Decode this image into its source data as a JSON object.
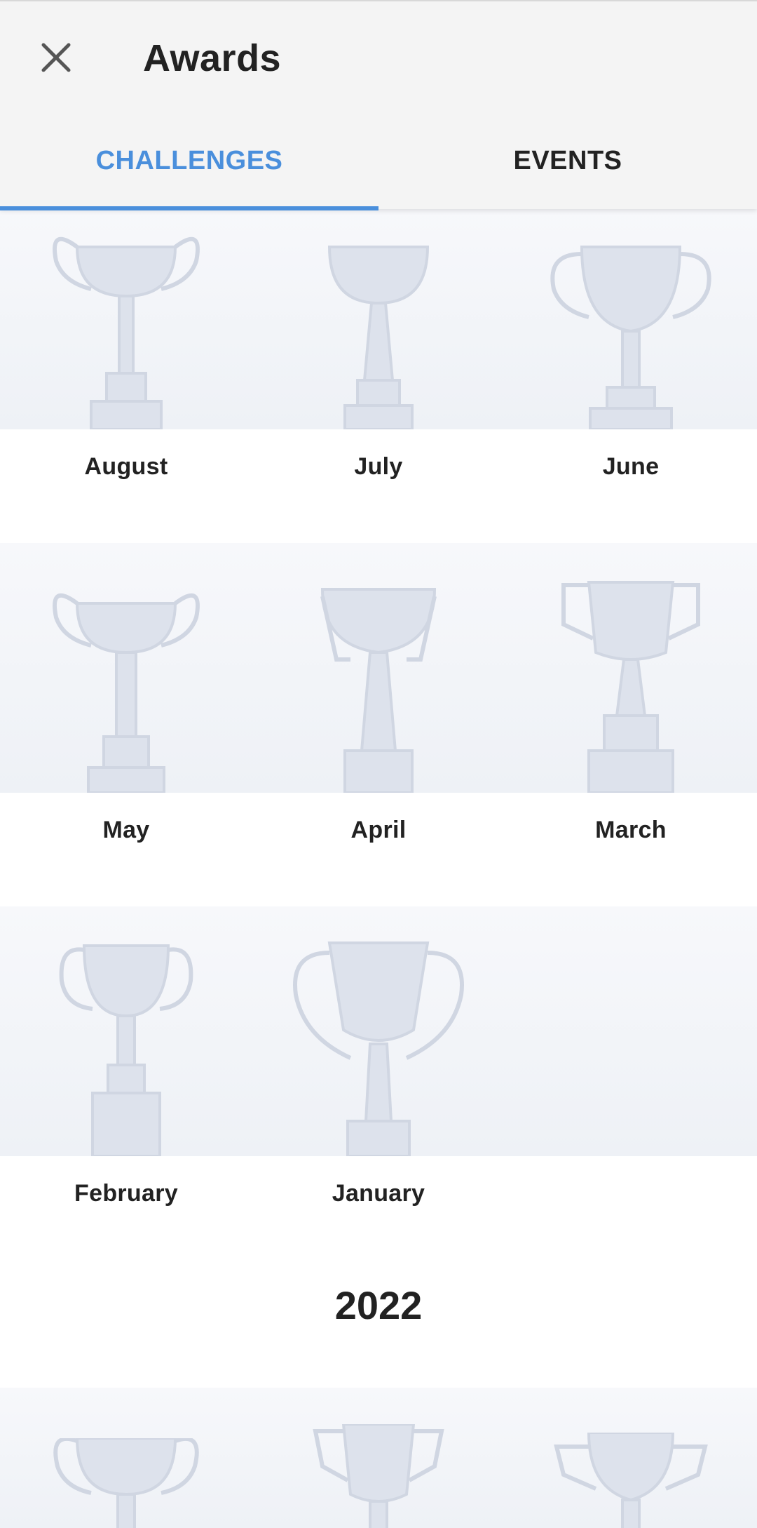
{
  "header": {
    "title": "Awards",
    "close_icon": "close-icon"
  },
  "tabs": [
    {
      "label": "CHALLENGES",
      "active": true
    },
    {
      "label": "EVENTS",
      "active": false
    }
  ],
  "awards": [
    {
      "label": "August"
    },
    {
      "label": "July"
    },
    {
      "label": "June"
    },
    {
      "label": "May"
    },
    {
      "label": "April"
    },
    {
      "label": "March"
    },
    {
      "label": "February"
    },
    {
      "label": "January"
    }
  ],
  "section_2022": {
    "year": "2022"
  },
  "colors": {
    "accent": "#4a8fdc",
    "appbar_bg": "#f4f4f4",
    "trophy": "#dde2ec"
  }
}
